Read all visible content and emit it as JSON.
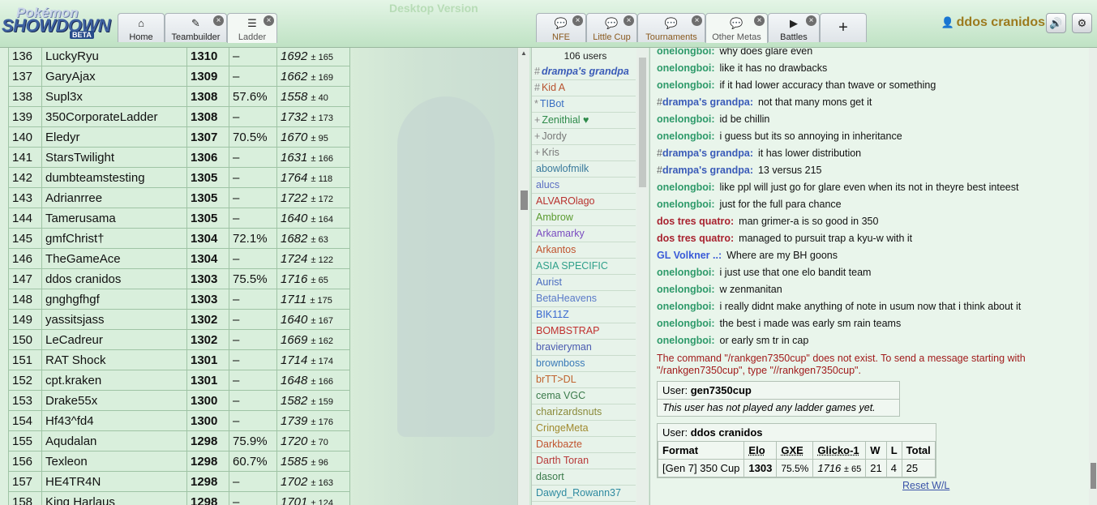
{
  "header": {
    "logo": {
      "top": "Pokémon",
      "main": "SHOWDOWN",
      "badge": "BETA"
    },
    "watermark": "Desktop Version",
    "tabs": [
      {
        "label": "Home",
        "icon": "home-icon",
        "glyph": "⌂"
      },
      {
        "label": "Teambuilder",
        "icon": "pencil-icon",
        "glyph": "✎",
        "closable": true
      },
      {
        "label": "Ladder",
        "icon": "list-icon",
        "glyph": "☰",
        "closable": true,
        "active": true
      },
      {
        "label": "NFE",
        "icon": "chat-icon",
        "glyph": "💬",
        "closable": true
      },
      {
        "label": "Little Cup",
        "icon": "chat-icon",
        "glyph": "💬",
        "closable": true
      },
      {
        "label": "Tournaments",
        "icon": "chat-icon",
        "glyph": "💬",
        "closable": true
      },
      {
        "label": "Other Metas",
        "icon": "chat-icon",
        "glyph": "💬",
        "closable": true,
        "active": true
      },
      {
        "label": "Battles",
        "icon": "battle-icon",
        "glyph": "▶",
        "closable": true
      }
    ],
    "new_tab": "+",
    "close_glyph": "×",
    "username": "ddos cranidos",
    "sound_glyph": "🔊",
    "settings_glyph": "⚙"
  },
  "ladder": {
    "rows": [
      {
        "rank": "136",
        "name": "LuckyRyu",
        "elo": "1310",
        "gxe": "–",
        "glicko": "1692",
        "dev": "± 165"
      },
      {
        "rank": "137",
        "name": "GaryAjax",
        "elo": "1309",
        "gxe": "–",
        "glicko": "1662",
        "dev": "± 169"
      },
      {
        "rank": "138",
        "name": "Supl3x",
        "elo": "1308",
        "gxe": "57.6%",
        "glicko": "1558",
        "dev": "± 40"
      },
      {
        "rank": "139",
        "name": "350CorporateLadder",
        "elo": "1308",
        "gxe": "–",
        "glicko": "1732",
        "dev": "± 173"
      },
      {
        "rank": "140",
        "name": "Eledyr",
        "elo": "1307",
        "gxe": "70.5%",
        "glicko": "1670",
        "dev": "± 95"
      },
      {
        "rank": "141",
        "name": "StarsTwilight",
        "elo": "1306",
        "gxe": "–",
        "glicko": "1631",
        "dev": "± 166"
      },
      {
        "rank": "142",
        "name": "dumbteamstesting",
        "elo": "1305",
        "gxe": "–",
        "glicko": "1764",
        "dev": "± 118"
      },
      {
        "rank": "143",
        "name": "Adrianrree",
        "elo": "1305",
        "gxe": "–",
        "glicko": "1722",
        "dev": "± 172"
      },
      {
        "rank": "144",
        "name": "Tamerusama",
        "elo": "1305",
        "gxe": "–",
        "glicko": "1640",
        "dev": "± 164"
      },
      {
        "rank": "145",
        "name": "gmfChrist†",
        "elo": "1304",
        "gxe": "72.1%",
        "glicko": "1682",
        "dev": "± 63"
      },
      {
        "rank": "146",
        "name": "TheGameAce",
        "elo": "1304",
        "gxe": "–",
        "glicko": "1724",
        "dev": "± 122"
      },
      {
        "rank": "147",
        "name": "ddos cranidos",
        "elo": "1303",
        "gxe": "75.5%",
        "glicko": "1716",
        "dev": "± 65"
      },
      {
        "rank": "148",
        "name": "gnghgfhgf",
        "elo": "1303",
        "gxe": "–",
        "glicko": "1711",
        "dev": "± 175"
      },
      {
        "rank": "149",
        "name": "yassitsjass",
        "elo": "1302",
        "gxe": "–",
        "glicko": "1640",
        "dev": "± 167"
      },
      {
        "rank": "150",
        "name": "LeCadreur",
        "elo": "1302",
        "gxe": "–",
        "glicko": "1669",
        "dev": "± 162"
      },
      {
        "rank": "151",
        "name": "RAT Shock",
        "elo": "1301",
        "gxe": "–",
        "glicko": "1714",
        "dev": "± 174"
      },
      {
        "rank": "152",
        "name": "cpt.kraken",
        "elo": "1301",
        "gxe": "–",
        "glicko": "1648",
        "dev": "± 166"
      },
      {
        "rank": "153",
        "name": "Drake55x",
        "elo": "1300",
        "gxe": "–",
        "glicko": "1582",
        "dev": "± 159"
      },
      {
        "rank": "154",
        "name": "Hf43^fd4",
        "elo": "1300",
        "gxe": "–",
        "glicko": "1739",
        "dev": "± 176"
      },
      {
        "rank": "155",
        "name": "Aqudalan",
        "elo": "1298",
        "gxe": "75.9%",
        "glicko": "1720",
        "dev": "± 70"
      },
      {
        "rank": "156",
        "name": "Texleon",
        "elo": "1298",
        "gxe": "60.7%",
        "glicko": "1585",
        "dev": "± 96"
      },
      {
        "rank": "157",
        "name": "HE4TR4N",
        "elo": "1298",
        "gxe": "–",
        "glicko": "1702",
        "dev": "± 163"
      },
      {
        "rank": "158",
        "name": "King Harlaus",
        "elo": "1298",
        "gxe": "–",
        "glicko": "1701",
        "dev": "± 124"
      }
    ]
  },
  "userlist": {
    "count": "106 users",
    "users": [
      {
        "group": "#",
        "name": "drampa's grandpa",
        "color": "#3a5bb8",
        "bold": true
      },
      {
        "group": "#",
        "name": "Kid A",
        "color": "#b8522f"
      },
      {
        "group": "*",
        "name": "TIBot",
        "color": "#3b6fc2"
      },
      {
        "group": "+",
        "name": "Zenithial ♥",
        "color": "#2e8a4a"
      },
      {
        "group": "+",
        "name": "Jordy",
        "color": "#777777"
      },
      {
        "group": "+",
        "name": "Kris",
        "color": "#777777"
      },
      {
        "group": "",
        "name": "abowlofmilk",
        "color": "#3a7a9c"
      },
      {
        "group": "",
        "name": "alucs",
        "color": "#5b6ec2"
      },
      {
        "group": "",
        "name": "ALVAROlago",
        "color": "#b8322f"
      },
      {
        "group": "",
        "name": "Ambrow",
        "color": "#5a9a2e"
      },
      {
        "group": "",
        "name": "Arkamarky",
        "color": "#7a4cc0"
      },
      {
        "group": "",
        "name": "Arkantos",
        "color": "#c0542f"
      },
      {
        "group": "",
        "name": "ASIA SPECIFIC",
        "color": "#2fa08a"
      },
      {
        "group": "",
        "name": "Aurist",
        "color": "#4a6cc0"
      },
      {
        "group": "",
        "name": "BetaHeavens",
        "color": "#5a7ac8"
      },
      {
        "group": "",
        "name": "BIK11Z",
        "color": "#3a6ad0"
      },
      {
        "group": "",
        "name": "BOMBSTRAP",
        "color": "#c0302f"
      },
      {
        "group": "",
        "name": "bravieryman",
        "color": "#4a5ab0"
      },
      {
        "group": "",
        "name": "brownboss",
        "color": "#3a7ab8"
      },
      {
        "group": "",
        "name": "brTT>DL",
        "color": "#c0642f"
      },
      {
        "group": "",
        "name": "cema VGC",
        "color": "#3a7a4a"
      },
      {
        "group": "",
        "name": "charizardsnuts",
        "color": "#8a8a3a"
      },
      {
        "group": "",
        "name": "CringeMeta",
        "color": "#a08a2e"
      },
      {
        "group": "",
        "name": "Darkbazte",
        "color": "#c0542f"
      },
      {
        "group": "",
        "name": "Darth Toran",
        "color": "#b83a3a"
      },
      {
        "group": "",
        "name": "dasort",
        "color": "#3a7a4a"
      },
      {
        "group": "",
        "name": "Dawyd_Rowann37",
        "color": "#2e8aa0"
      }
    ]
  },
  "chat": {
    "messages": [
      {
        "user": "onelongboi:",
        "color": "#2e9a6a",
        "text": "why does glare even"
      },
      {
        "user": "onelongboi:",
        "color": "#2e9a6a",
        "text": "like it has no drawbacks"
      },
      {
        "user": "onelongboi:",
        "color": "#2e9a6a",
        "text": "if it had lower accuracy than twave or something"
      },
      {
        "user": "drampa's grandpa:",
        "hash": "#",
        "color": "#3a5bb8",
        "text": "not that many mons get it"
      },
      {
        "user": "onelongboi:",
        "color": "#2e9a6a",
        "text": "id be chillin"
      },
      {
        "user": "onelongboi:",
        "color": "#2e9a6a",
        "text": "i guess but its so annoying in inheritance"
      },
      {
        "user": "drampa's grandpa:",
        "hash": "#",
        "color": "#3a5bb8",
        "text": "it has lower distribution"
      },
      {
        "user": "drampa's grandpa:",
        "hash": "#",
        "color": "#3a5bb8",
        "text": "13 versus 215"
      },
      {
        "user": "onelongboi:",
        "color": "#2e9a6a",
        "text": "like ppl will just go for glare even when its not in theyre best inteest"
      },
      {
        "user": "onelongboi:",
        "color": "#2e9a6a",
        "text": "just for the full para chance"
      },
      {
        "user": "dos tres quatro:",
        "color": "#a8222f",
        "text": "man grimer-a is so good in 350"
      },
      {
        "user": "dos tres quatro:",
        "color": "#a8222f",
        "text": "managed to pursuit trap a kyu-w with it"
      },
      {
        "user": "GL Volkner ..:",
        "color": "#3a5bd8",
        "text": "Where are my BH goons"
      },
      {
        "user": "onelongboi:",
        "color": "#2e9a6a",
        "text": "i just use that one elo bandit team"
      },
      {
        "user": "onelongboi:",
        "color": "#2e9a6a",
        "text": "w zenmanitan"
      },
      {
        "user": "onelongboi:",
        "color": "#2e9a6a",
        "text": "i really didnt make anything of note in usum now that i think about it"
      },
      {
        "user": "onelongboi:",
        "color": "#2e9a6a",
        "text": "the best i made was early sm rain teams"
      },
      {
        "user": "onelongboi:",
        "color": "#2e9a6a",
        "text": "or early sm tr in cap"
      }
    ],
    "error_line1": "The command \"/rankgen7350cup\" does not exist. To send a message starting with",
    "error_line2": "\"/rankgen7350cup\", type \"//rankgen7350cup\".",
    "box1": {
      "user_label": "User:",
      "user": "gen7350cup",
      "note": "This user has not played any ladder games yet."
    },
    "box2": {
      "user_label": "User:",
      "user": "ddos cranidos",
      "headers": [
        "Format",
        "Elo",
        "GXE",
        "Glicko-1",
        "W",
        "L",
        "Total"
      ],
      "row": {
        "format": "[Gen 7] 350 Cup",
        "elo": "1303",
        "gxe": "75.5%",
        "glicko": "1716",
        "dev": "± 65",
        "w": "21",
        "l": "4",
        "total": "25"
      }
    },
    "reset": "Reset W/L"
  }
}
